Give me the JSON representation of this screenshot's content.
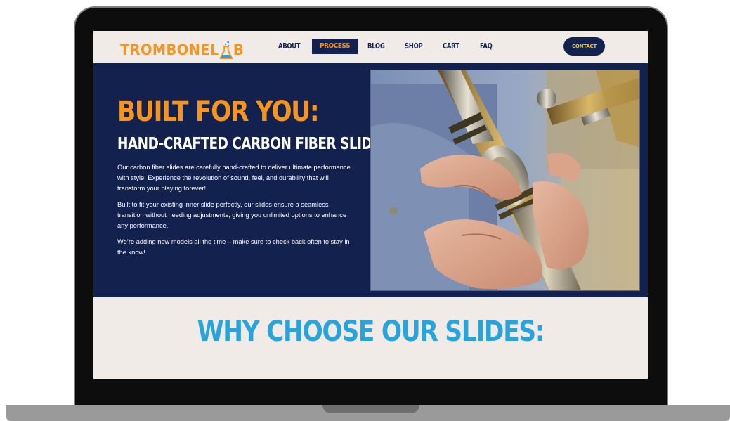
{
  "site": {
    "logo_part1": "TROMBONEL",
    "logo_part2": "B"
  },
  "nav": {
    "items": [
      {
        "label": "ABOUT"
      },
      {
        "label": "PROCESS"
      },
      {
        "label": "BLOG"
      },
      {
        "label": "SHOP"
      },
      {
        "label": "CART"
      },
      {
        "label": "FAQ"
      }
    ],
    "active": "PROCESS",
    "contact_label": "CONTACT"
  },
  "hero": {
    "title": "BUILT FOR YOU:",
    "subtitle": "HAND-CRAFTED CARBON FIBER SLIDES",
    "paragraphs": [
      "Our carbon fiber slides are carefully hand-crafted to deliver ultimate performance with style! Experience the revolution of sound, feel, and durability that will transform your playing forever!",
      "Built to fit your existing inner slide perfectly, our slides ensure a seamless transition without needing adjustments, giving you unlimited options to enhance any performance.",
      "We’re adding new models all the time – make sure to check back often to stay in the know!"
    ]
  },
  "why": {
    "title": "WHY CHOOSE OUR SLIDES:"
  },
  "colors": {
    "navy": "#13214f",
    "orange": "#f7941d",
    "sky": "#29a3dc",
    "cream": "#f0ebe6"
  }
}
